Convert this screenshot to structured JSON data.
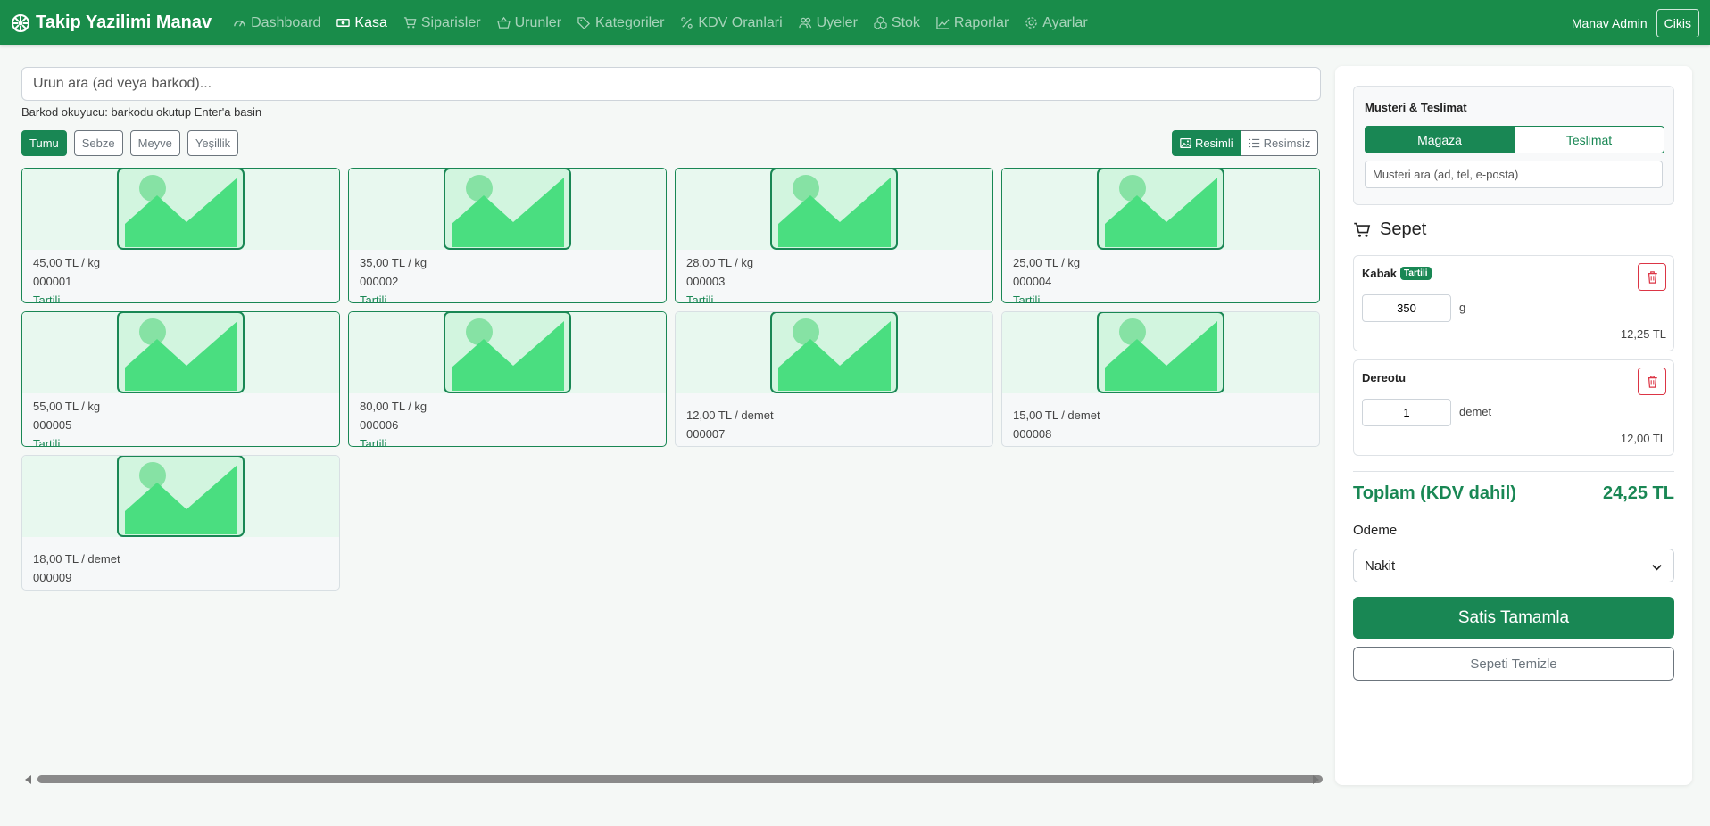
{
  "navbar": {
    "brand": "Takip Yazilimi Manav",
    "items": [
      {
        "label": "Dashboard",
        "icon": "speedometer-icon",
        "active": false
      },
      {
        "label": "Kasa",
        "icon": "cash-icon",
        "active": true
      },
      {
        "label": "Siparisler",
        "icon": "cart-icon",
        "active": false
      },
      {
        "label": "Urunler",
        "icon": "basket-icon",
        "active": false
      },
      {
        "label": "Kategoriler",
        "icon": "tags-icon",
        "active": false
      },
      {
        "label": "KDV Oranlari",
        "icon": "percent-icon",
        "active": false
      },
      {
        "label": "Uyeler",
        "icon": "people-icon",
        "active": false
      },
      {
        "label": "Stok",
        "icon": "boxes-icon",
        "active": false
      },
      {
        "label": "Raporlar",
        "icon": "graph-icon",
        "active": false
      },
      {
        "label": "Ayarlar",
        "icon": "gear-icon",
        "active": false
      }
    ],
    "user": "Manav Admin",
    "logout": "Cikis"
  },
  "search": {
    "placeholder": "Urun ara (ad veya barkod)..."
  },
  "barcode_hint": "Barkod okuyucu: barkodu okutup Enter'a basin",
  "filters": [
    {
      "label": "Tumu",
      "active": true
    },
    {
      "label": "Sebze",
      "active": false
    },
    {
      "label": "Meyve",
      "active": false
    },
    {
      "label": "Yeşillik",
      "active": false
    }
  ],
  "view_toggle": {
    "with_image": "Resimli",
    "without_image": "Resimsiz"
  },
  "products": [
    {
      "price": "45,00 TL / kg",
      "code": "000001",
      "tag": "Tartili"
    },
    {
      "price": "35,00 TL / kg",
      "code": "000002",
      "tag": "Tartili"
    },
    {
      "price": "28,00 TL / kg",
      "code": "000003",
      "tag": "Tartili"
    },
    {
      "price": "25,00 TL / kg",
      "code": "000004",
      "tag": "Tartili"
    },
    {
      "price": "55,00 TL / kg",
      "code": "000005",
      "tag": "Tartili"
    },
    {
      "price": "80,00 TL / kg",
      "code": "000006",
      "tag": "Tartili"
    },
    {
      "price": "12,00 TL / demet",
      "code": "000007",
      "tag": ""
    },
    {
      "price": "15,00 TL / demet",
      "code": "000008",
      "tag": ""
    },
    {
      "price": "18,00 TL / demet",
      "code": "000009",
      "tag": ""
    }
  ],
  "customer": {
    "title": "Musteri & Teslimat",
    "tab_store": "Magaza",
    "tab_delivery": "Teslimat",
    "search_placeholder": "Musteri ara (ad, tel, e-posta)"
  },
  "cart": {
    "title": "Sepet",
    "items": [
      {
        "name": "Kabak",
        "badge": "Tartili",
        "qty": "350",
        "unit": "g",
        "total": "12,25 TL"
      },
      {
        "name": "Dereotu",
        "badge": "",
        "qty": "1",
        "unit": "demet",
        "total": "12,00 TL"
      }
    ],
    "total_label": "Toplam (KDV dahil)",
    "total_value": "24,25 TL",
    "payment_label": "Odeme",
    "payment_value": "Nakit",
    "complete": "Satis Tamamla",
    "clear": "Sepeti Temizle"
  },
  "colors": {
    "primary": "#198754",
    "navbar": "#198c4a",
    "danger": "#dc3545"
  }
}
